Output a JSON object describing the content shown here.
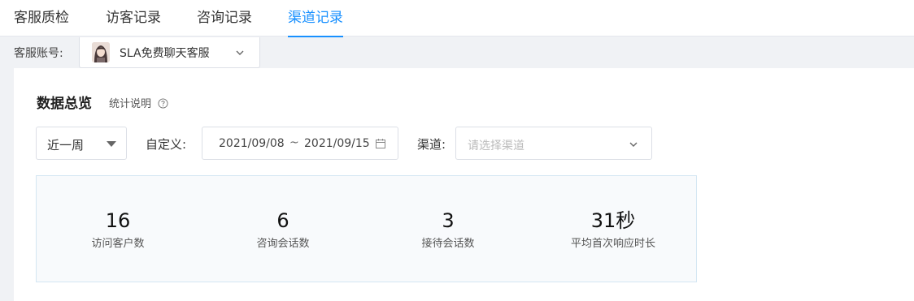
{
  "tabs": [
    {
      "label": "客服质检",
      "active": false
    },
    {
      "label": "访客记录",
      "active": false
    },
    {
      "label": "咨询记录",
      "active": false
    },
    {
      "label": "渠道记录",
      "active": true
    }
  ],
  "account": {
    "label": "客服账号:",
    "value": "SLA免费聊天客服",
    "avatar_icon": "user-avatar"
  },
  "overview": {
    "title": "数据总览",
    "help_label": "统计说明",
    "help_icon": "question-circle-icon"
  },
  "filters": {
    "period_value": "近一周",
    "custom_label": "自定义:",
    "date_start": "2021/09/08",
    "date_sep": "~",
    "date_end": "2021/09/15",
    "channel_label": "渠道:",
    "channel_placeholder": "请选择渠道"
  },
  "stats": [
    {
      "value": "16",
      "label": "访问客户数"
    },
    {
      "value": "6",
      "label": "咨询会话数"
    },
    {
      "value": "3",
      "label": "接待会话数"
    },
    {
      "value": "31秒",
      "label": "平均首次响应时长"
    }
  ],
  "colors": {
    "accent": "#1890ff",
    "page_bg": "#f0f2f5",
    "stats_bg": "#f8fafc",
    "stats_border": "#d4e6f3"
  }
}
